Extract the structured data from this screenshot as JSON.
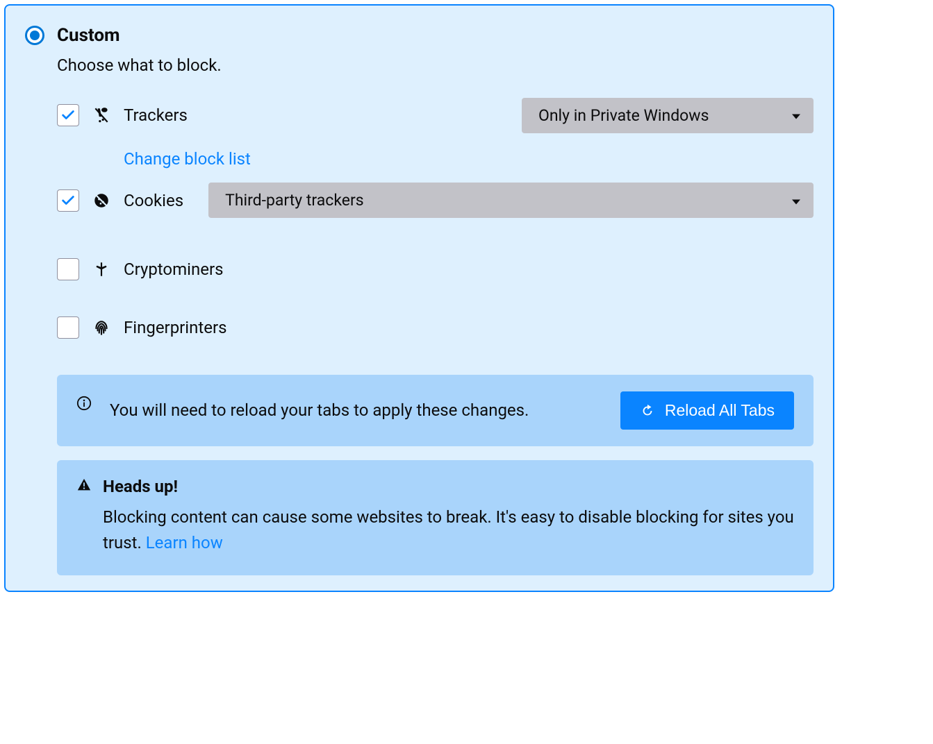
{
  "header": {
    "title": "Custom",
    "subtitle": "Choose what to block."
  },
  "options": {
    "trackers": {
      "label": "Trackers",
      "checked": true,
      "select_value": "Only in Private Windows",
      "change_link": "Change block list"
    },
    "cookies": {
      "label": "Cookies",
      "checked": true,
      "select_value": "Third-party trackers"
    },
    "cryptominers": {
      "label": "Cryptominers",
      "checked": false
    },
    "fingerprinters": {
      "label": "Fingerprinters",
      "checked": false
    }
  },
  "reload": {
    "message": "You will need to reload your tabs to apply these changes.",
    "button": "Reload All Tabs"
  },
  "warning": {
    "title": "Heads up!",
    "body_pre": "Blocking content can cause some websites to break. It's easy to disable blocking for sites you trust.  ",
    "learn": "Learn how"
  }
}
